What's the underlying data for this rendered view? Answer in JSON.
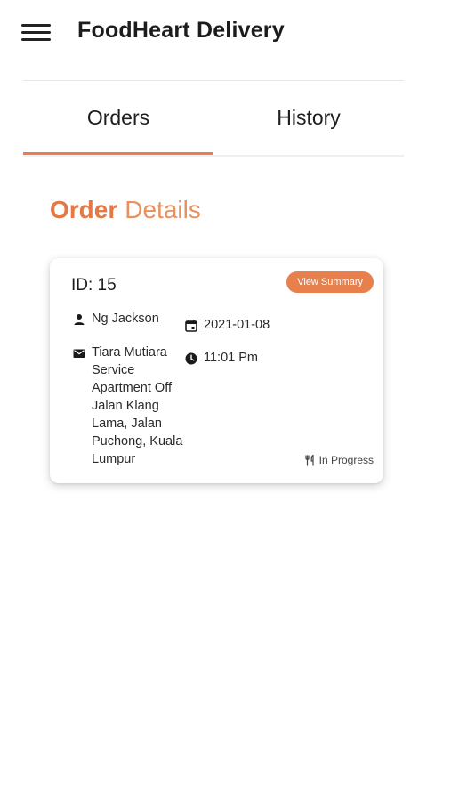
{
  "app": {
    "title": "FoodHeart Delivery",
    "accent_color": "#e8804d"
  },
  "tabs": [
    {
      "label": "Orders",
      "active": true
    },
    {
      "label": "History",
      "active": false
    }
  ],
  "section": {
    "heading_strong": "Order",
    "heading_light": "Details"
  },
  "order": {
    "id_text": "ID: 15",
    "view_summary_label": "View Summary",
    "customer_name": "Ng Jackson",
    "customer_icon": "person-icon",
    "address": "Tiara Mutiara Service Apartment Off Jalan Klang Lama, Jalan Puchong, Kuala Lumpur",
    "address_icon": "mail-icon",
    "date": "2021-01-08",
    "date_icon": "calendar-icon",
    "time": "11:01 Pm",
    "time_icon": "clock-icon",
    "status": "In Progress",
    "status_icon": "utensils-icon"
  }
}
